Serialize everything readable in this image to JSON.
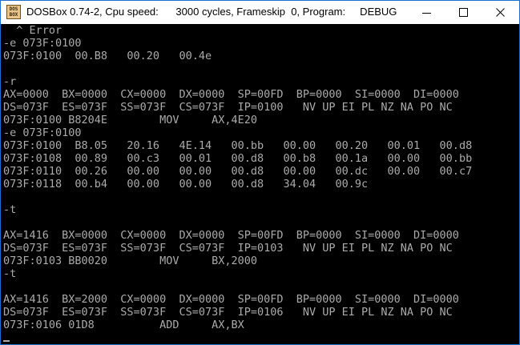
{
  "window": {
    "title": "DOSBox 0.74-2, Cpu speed:      3000 cycles, Frameskip  0, Program:     DEBUG",
    "icon_label": "DOS BOX",
    "controls": {
      "minimize_icon": "minimize-icon",
      "maximize_icon": "maximize-icon",
      "close_icon": "close-icon"
    }
  },
  "terminal": {
    "text_color": "#aaaaaa",
    "background": "#000000",
    "lines": [
      "  ^ Error",
      "-e 073F:0100",
      "073F:0100  00.B8   00.20   00.4e",
      "",
      "-r",
      "AX=0000  BX=0000  CX=0000  DX=0000  SP=00FD  BP=0000  SI=0000  DI=0000",
      "DS=073F  ES=073F  SS=073F  CS=073F  IP=0100   NV UP EI PL NZ NA PO NC",
      "073F:0100 B8204E        MOV     AX,4E20",
      "-e 073F:0100",
      "073F:0100  B8.05   20.16   4E.14   00.bb   00.00   00.20   00.01   00.d8",
      "073F:0108  00.89   00.c3   00.01   00.d8   00.b8   00.1a   00.00   00.bb",
      "073F:0110  00.26   00.00   00.00   00.d8   00.00   00.dc   00.00   00.c7",
      "073F:0118  00.b4   00.00   00.00   00.d8   34.04   00.9c",
      "",
      "-t",
      "",
      "AX=1416  BX=0000  CX=0000  DX=0000  SP=00FD  BP=0000  SI=0000  DI=0000",
      "DS=073F  ES=073F  SS=073F  CS=073F  IP=0103   NV UP EI PL NZ NA PO NC",
      "073F:0103 BB0020        MOV     BX,2000",
      "-t",
      "",
      "AX=1416  BX=2000  CX=0000  DX=0000  SP=00FD  BP=0000  SI=0000  DI=0000",
      "DS=073F  ES=073F  SS=073F  CS=073F  IP=0106   NV UP EI PL NZ NA PO NC",
      "073F:0106 01D8          ADD     AX,BX"
    ]
  }
}
